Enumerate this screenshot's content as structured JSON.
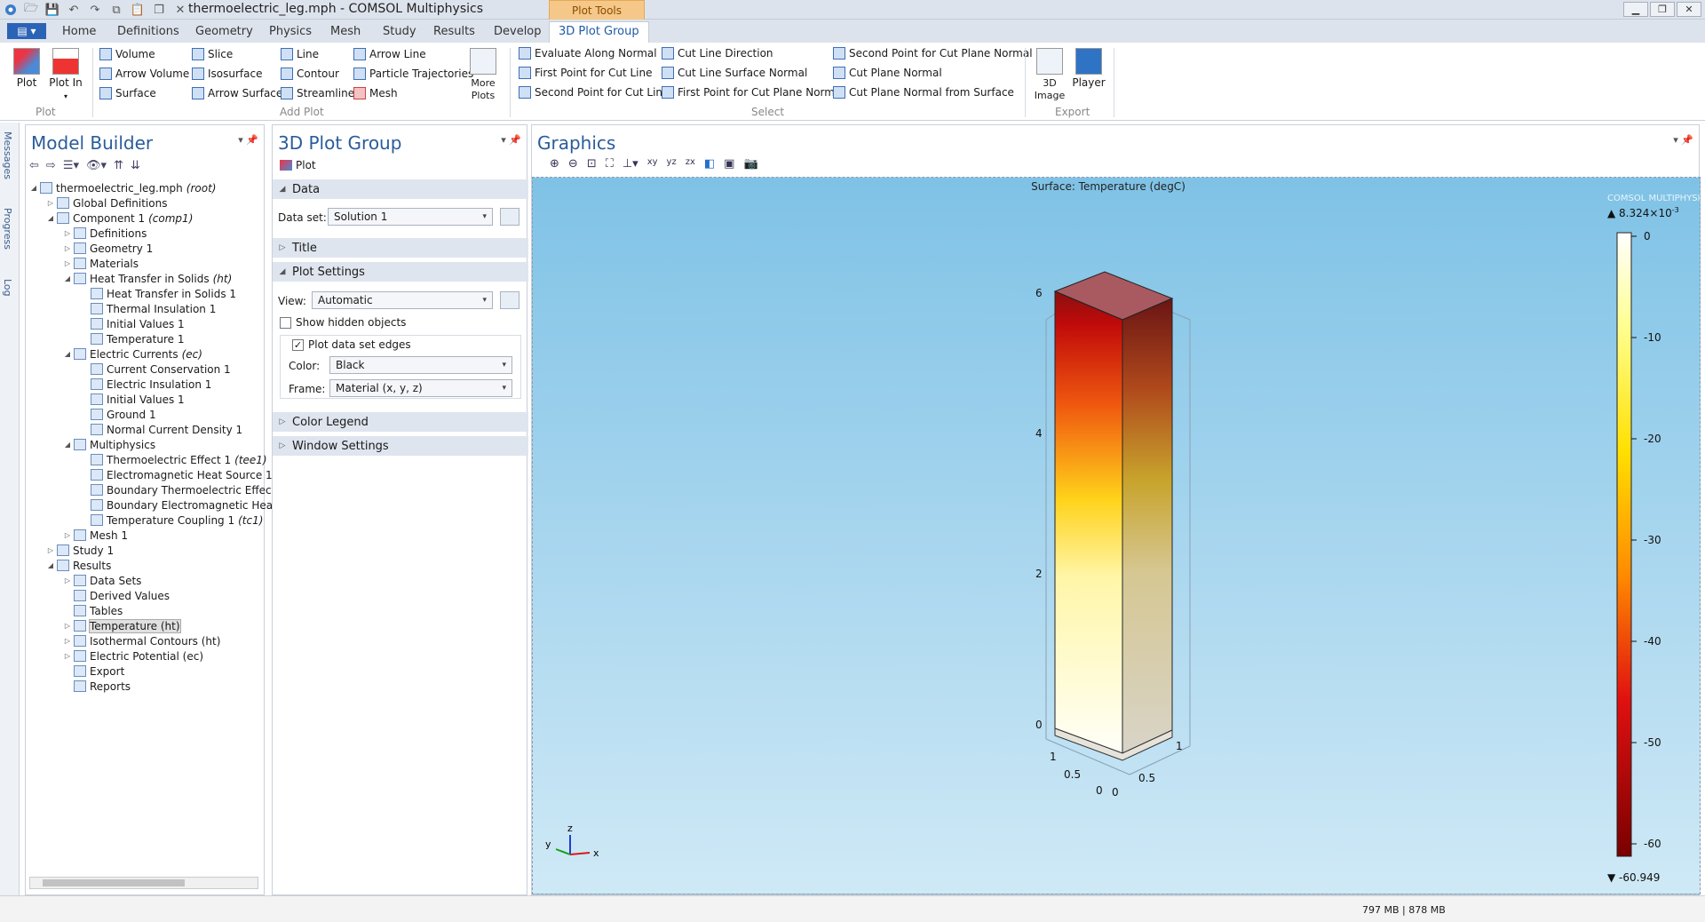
{
  "title": "thermoelectric_leg.mph - COMSOL Multiphysics",
  "context_tab": "Plot Tools",
  "window_buttons": [
    "▁",
    "❐",
    "✕"
  ],
  "tabs": [
    "Home",
    "Definitions",
    "Geometry",
    "Physics",
    "Mesh",
    "Study",
    "Results",
    "Develop",
    "3D Plot Group"
  ],
  "ribbon": {
    "plot": "Plot",
    "plot_in": "Plot In",
    "plot_group_label": "Plot",
    "add_plot_items": [
      "Volume",
      "Arrow Volume",
      "Surface",
      "Slice",
      "Isosurface",
      "Arrow Surface",
      "Line",
      "Contour",
      "Streamline",
      "Arrow Line",
      "Particle Trajectories",
      "Mesh"
    ],
    "more_plots": "More Plots",
    "add_plot_label": "Add Plot",
    "select_items": [
      "Evaluate Along Normal",
      "First Point for Cut Line",
      "Second Point for Cut Line",
      "Cut Line Direction",
      "Cut Line Surface Normal",
      "First Point for Cut Plane Normal",
      "Second Point for Cut Plane Normal",
      "Cut Plane Normal",
      "Cut Plane Normal from Surface"
    ],
    "select_label": "Select",
    "image_3d": "3D Image",
    "player": "Player",
    "export_label": "Export"
  },
  "side_labels": [
    "Messages",
    "Progress",
    "Log"
  ],
  "model_builder": {
    "title": "Model Builder",
    "tree": [
      {
        "label": "thermoelectric_leg.mph",
        "tag": "(root)",
        "depth": 0,
        "open": true
      },
      {
        "label": "Global Definitions",
        "depth": 1,
        "open": false
      },
      {
        "label": "Component 1",
        "tag": "(comp1)",
        "depth": 1,
        "open": true
      },
      {
        "label": "Definitions",
        "depth": 2,
        "open": false
      },
      {
        "label": "Geometry 1",
        "depth": 2,
        "open": false
      },
      {
        "label": "Materials",
        "depth": 2,
        "open": false
      },
      {
        "label": "Heat Transfer in Solids",
        "tag": "(ht)",
        "depth": 2,
        "open": true
      },
      {
        "label": "Heat Transfer in Solids 1",
        "depth": 3
      },
      {
        "label": "Thermal Insulation 1",
        "depth": 3
      },
      {
        "label": "Initial Values 1",
        "depth": 3
      },
      {
        "label": "Temperature 1",
        "depth": 3
      },
      {
        "label": "Electric Currents",
        "tag": "(ec)",
        "depth": 2,
        "open": true
      },
      {
        "label": "Current Conservation 1",
        "depth": 3
      },
      {
        "label": "Electric Insulation 1",
        "depth": 3
      },
      {
        "label": "Initial Values 1",
        "depth": 3
      },
      {
        "label": "Ground 1",
        "depth": 3
      },
      {
        "label": "Normal Current Density 1",
        "depth": 3
      },
      {
        "label": "Multiphysics",
        "depth": 2,
        "open": true
      },
      {
        "label": "Thermoelectric Effect 1",
        "tag": "(tee1)",
        "depth": 3
      },
      {
        "label": "Electromagnetic Heat Source 1",
        "depth": 3
      },
      {
        "label": "Boundary Thermoelectric Effect",
        "depth": 3
      },
      {
        "label": "Boundary Electromagnetic Heat",
        "depth": 3
      },
      {
        "label": "Temperature Coupling 1",
        "tag": "(tc1)",
        "depth": 3
      },
      {
        "label": "Mesh 1",
        "depth": 2,
        "open": false
      },
      {
        "label": "Study 1",
        "depth": 1,
        "open": false
      },
      {
        "label": "Results",
        "depth": 1,
        "open": true
      },
      {
        "label": "Data Sets",
        "depth": 2,
        "open": false
      },
      {
        "label": "Derived Values",
        "depth": 2
      },
      {
        "label": "Tables",
        "depth": 2
      },
      {
        "label": "Temperature (ht)",
        "depth": 2,
        "open": false,
        "selected": true
      },
      {
        "label": "Isothermal Contours (ht)",
        "depth": 2,
        "open": false
      },
      {
        "label": "Electric Potential (ec)",
        "depth": 2,
        "open": false
      },
      {
        "label": "Export",
        "depth": 2
      },
      {
        "label": "Reports",
        "depth": 2
      }
    ]
  },
  "settings": {
    "title": "3D Plot Group",
    "plot_button": "Plot",
    "section_data": "Data",
    "dataset_label": "Data set:",
    "dataset_value": "Solution 1",
    "section_title": "Title",
    "section_plot_settings": "Plot Settings",
    "view_label": "View:",
    "view_value": "Automatic",
    "show_hidden": "Show hidden objects",
    "plot_edges": "Plot data set edges",
    "color_label": "Color:",
    "color_value": "Black",
    "frame_label": "Frame:",
    "frame_value": "Material (x, y, z)",
    "section_color_legend": "Color Legend",
    "section_window": "Window Settings"
  },
  "graphics": {
    "title": "Graphics",
    "plot_title": "Surface: Temperature (degC)",
    "watermark": "COMSOL MULTIPHYSICS",
    "max_label": "▲ 8.324×10",
    "max_exp": "-3",
    "min_label": "▼ -60.949",
    "colorbar_ticks": [
      "0",
      "-10",
      "-20",
      "-30",
      "-40",
      "-50",
      "-60"
    ],
    "z_ticks": [
      "6",
      "4",
      "2",
      "0"
    ],
    "x_ticks": [
      "1",
      "0.5",
      "0"
    ],
    "y_ticks": [
      "1",
      "0.5",
      "0"
    ],
    "axes": {
      "x": "x",
      "y": "y",
      "z": "z"
    }
  },
  "status": {
    "memory": "797 MB | 878 MB"
  }
}
